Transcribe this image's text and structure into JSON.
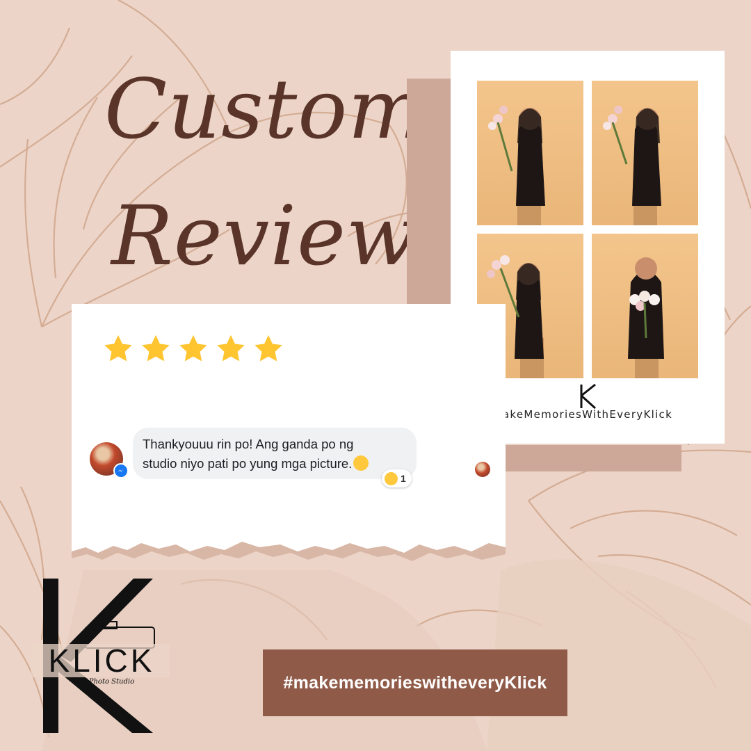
{
  "title": {
    "line1": "Customer",
    "line2": "Review"
  },
  "review": {
    "rating": 5,
    "message_line1": "Thankyouuu rin po! Ang ganda po ng",
    "message_line2": "studio niyo pati po yung mga picture.",
    "reaction_count": "1"
  },
  "photo_strip": {
    "caption": "akeMemoriesWithEveryKlick",
    "logo_text": "KLICK"
  },
  "brand": {
    "name": "KLICK",
    "tagline": "Self Photo Studio"
  },
  "hashtag": "#makememorieswitheveryKlick",
  "colors": {
    "background": "#ecd5c8",
    "title": "#5a3428",
    "hashtag_box": "#8f5a48",
    "star": "#ffc531",
    "accent_block": "#cda898"
  }
}
